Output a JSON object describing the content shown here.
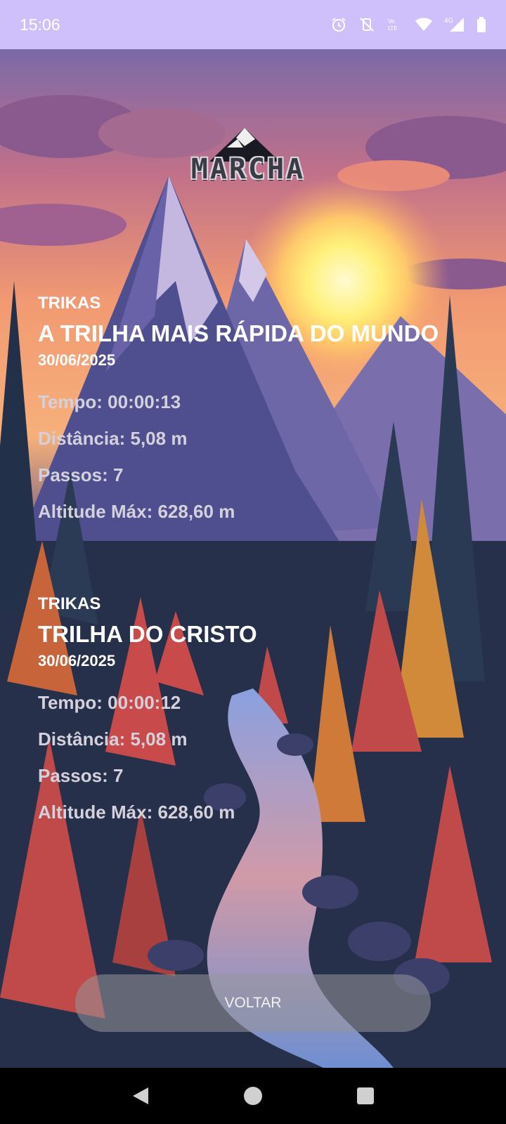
{
  "status_bar": {
    "time": "15:06",
    "icons": [
      "alarm-icon",
      "vibrate-off-icon",
      "volte-icon",
      "wifi-icon",
      "signal-4g-icon",
      "battery-icon"
    ],
    "network_label": "4G"
  },
  "app": {
    "logo_text": "MARCHA"
  },
  "hikes": [
    {
      "user": "TRIKAS",
      "title": "A TRILHA MAIS RÁPIDA DO MUNDO",
      "date": "30/06/2025",
      "time": "Tempo: 00:00:13",
      "distance": "Distância: 5,08 m",
      "steps": "Passos: 7",
      "max_altitude": "Altitude Máx: 628,60 m"
    },
    {
      "user": "TRIKAS",
      "title": "TRILHA DO CRISTO",
      "date": "30/06/2025",
      "time": "Tempo: 00:00:12",
      "distance": "Distância: 5,08 m",
      "steps": "Passos: 7",
      "max_altitude": "Altitude Máx: 628,60 m"
    }
  ],
  "back_button": {
    "label": "VOLTAR"
  },
  "colors": {
    "status_bar": "#cfc0fb",
    "sky_top": "#6a5a9a",
    "sunset": "#f08a6a",
    "sun": "#fff07a",
    "mountain": "#5d5a9a",
    "forest": "#2a3550",
    "river": "#6f8fd0"
  }
}
